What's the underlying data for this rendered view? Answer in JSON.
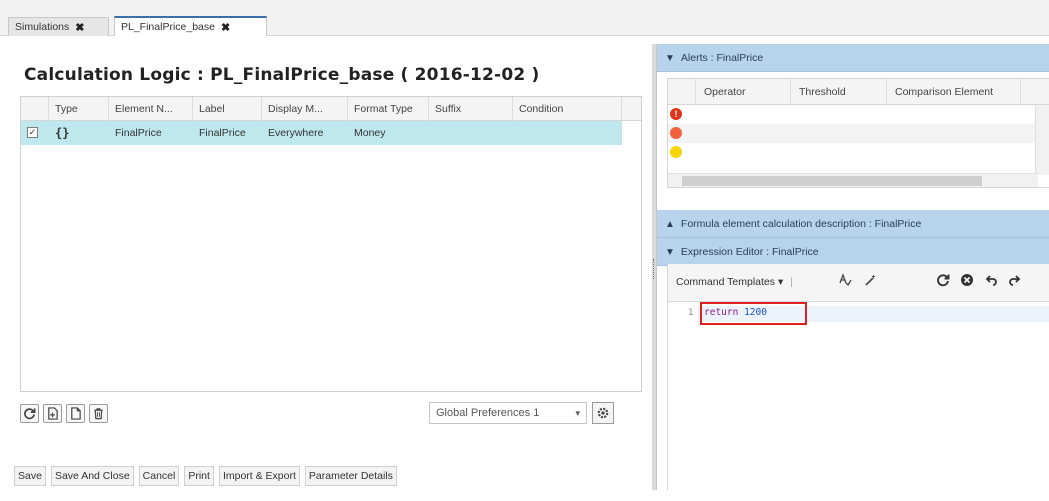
{
  "tabs": [
    {
      "label": "Simulations",
      "close": "✖"
    },
    {
      "label": "PL_FinalPrice_base",
      "close": "✖"
    }
  ],
  "left": {
    "title": "Calculation Logic : PL_FinalPrice_base ( 2016-12-02 )",
    "columns": [
      "Type",
      "Element N...",
      "Label",
      "Display M...",
      "Format Type",
      "Suffix",
      "Condition"
    ],
    "row": {
      "checked": "✓",
      "type": "{}",
      "element_name": "FinalPrice",
      "label": "FinalPrice",
      "display_mode": "Everywhere",
      "format_type": "Money",
      "suffix": "",
      "condition": ""
    },
    "icons": [
      "refresh-icon",
      "add-document-icon",
      "document-icon",
      "trash-icon"
    ],
    "preferences": {
      "selected": "Global Preferences 1",
      "caret": "▾"
    },
    "bottom_buttons": [
      "Save",
      "Save And Close",
      "Cancel",
      "Print",
      "Import & Export",
      "Parameter Details"
    ]
  },
  "right": {
    "alerts_header": "Alerts : FinalPrice",
    "alert_columns": [
      "Operator",
      "Threshold",
      "Comparison Element"
    ],
    "alert_levels": [
      {
        "color": "#e0341c",
        "glyph": "!"
      },
      {
        "color": "#f2623c",
        "glyph": ""
      },
      {
        "color": "#f6d400",
        "glyph": ""
      }
    ],
    "formula_header": "Formula element calculation description : FinalPrice",
    "expression_header": "Expression Editor : FinalPrice",
    "command_templates": "Command Templates",
    "command_caret": "▾",
    "line_number": "1",
    "code_keyword": "return",
    "code_value": "1200"
  },
  "colors": {
    "section_bar": "#b8d3ec",
    "selected_row": "#bfe8ee",
    "highlight_box": "#e02020"
  }
}
